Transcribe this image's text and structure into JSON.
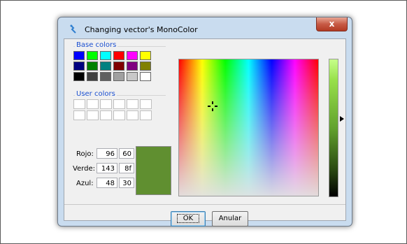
{
  "dialog": {
    "title": "Changing vector's MonoColor",
    "close_label": "x"
  },
  "base_colors": {
    "label": "Base colors",
    "swatches": [
      "#0000ff",
      "#00ff00",
      "#00ffff",
      "#ff0000",
      "#ff00ff",
      "#ffff00",
      "#000080",
      "#008000",
      "#008080",
      "#800000",
      "#800080",
      "#808000",
      "#000000",
      "#404040",
      "#606060",
      "#a0a0a0",
      "#c8c8c8",
      "#ffffff"
    ]
  },
  "user_colors": {
    "label": "User colors"
  },
  "fields": {
    "red_label": "Rojo:",
    "red_dec": "96",
    "red_hex": "60",
    "green_label": "Verde:",
    "green_dec": "143",
    "green_hex": "8f",
    "blue_label": "Azul:",
    "blue_dec": "48",
    "blue_hex": "30"
  },
  "preview_color": "#608f30",
  "buttons": {
    "ok": "OK",
    "cancel": "Anular"
  },
  "icons": {
    "app": "app-icon",
    "close": "close-icon",
    "crosshair": "crosshair-icon",
    "arrow": "arrow-right-icon"
  }
}
